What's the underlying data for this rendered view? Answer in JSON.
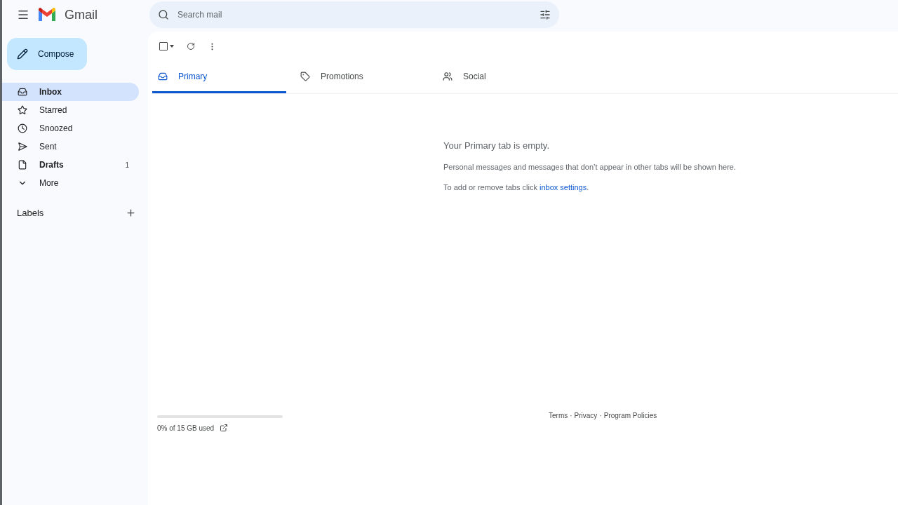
{
  "app": {
    "name": "Gmail"
  },
  "search": {
    "placeholder": "Search mail"
  },
  "compose": {
    "label": "Compose"
  },
  "sidebar": {
    "items": [
      {
        "label": "Inbox",
        "selected": true,
        "unread": true
      },
      {
        "label": "Starred",
        "selected": false,
        "unread": false
      },
      {
        "label": "Snoozed",
        "selected": false,
        "unread": false
      },
      {
        "label": "Sent",
        "selected": false,
        "unread": false
      },
      {
        "label": "Drafts",
        "selected": false,
        "unread": true,
        "count": "1"
      },
      {
        "label": "More",
        "selected": false,
        "unread": false
      }
    ],
    "labels_heading": "Labels"
  },
  "toolbar": {
    "select_all_checked": false
  },
  "tabs": [
    {
      "label": "Primary",
      "selected": true
    },
    {
      "label": "Promotions",
      "selected": false
    },
    {
      "label": "Social",
      "selected": false
    }
  ],
  "empty_state": {
    "title": "Your Primary tab is empty.",
    "message": "Personal messages and messages that don’t appear in other tabs will be shown here.",
    "hint_prefix": "To add or remove tabs click ",
    "hint_link": "inbox settings",
    "hint_suffix": "."
  },
  "storage": {
    "level": 0,
    "label": "0% of 15 GB used"
  },
  "footer": {
    "links": [
      "Terms",
      "Privacy",
      "Program Policies"
    ],
    "separator": "·"
  }
}
